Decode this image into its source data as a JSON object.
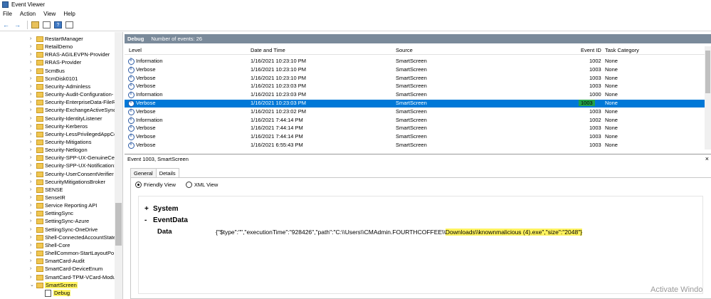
{
  "window": {
    "title": "Event Viewer"
  },
  "menu": [
    "File",
    "Action",
    "View",
    "Help"
  ],
  "toolbar": {
    "back_icon": "arrow-left-icon",
    "forward_icon": "arrow-right-icon",
    "folder_icon": "folder-up-icon",
    "properties_icon": "properties-icon",
    "help_icon": "help-icon",
    "panel_icon": "show-hide-pane-icon",
    "help_label": "?"
  },
  "tree": {
    "items": [
      "RestartManager",
      "RetailDemo",
      "RRAS-AGILEVPN-Provider",
      "RRAS-Provider",
      "ScmBus",
      "ScmDisk0101",
      "Security-Adminless",
      "Security-Audit-Configuration-",
      "Security-EnterpriseData-FileRe",
      "Security-ExchangeActiveSync",
      "Security-IdentityListener",
      "Security-Kerberos",
      "Security-LessPrivilegedAppCo",
      "Security-Mitigations",
      "Security-Netlogon",
      "Security-SPP-UX-GenuineCen",
      "Security-SPP-UX-Notification:",
      "Security-UserConsentVerifier",
      "SecurityMitigationsBroker",
      "SENSE",
      "SenseIR",
      "Service Reporting API",
      "SettingSync",
      "SettingSync-Azure",
      "SettingSync-OneDrive",
      "Shell-ConnectedAccountState",
      "Shell-Core",
      "ShellCommon-StartLayoutPo",
      "SmartCard-Audit",
      "SmartCard-DeviceEnum",
      "SmartCard-TPM-VCard-Modu"
    ],
    "selected": "SmartScreen",
    "child": "Debug"
  },
  "log": {
    "name": "Debug",
    "count_label": "Number of events: 26"
  },
  "grid": {
    "columns": [
      "Level",
      "Date and Time",
      "Source",
      "Event ID",
      "Task Category"
    ],
    "rows": [
      [
        "Information",
        "1/16/2021 10:23:10 PM",
        "SmartScreen",
        "1002",
        "None"
      ],
      [
        "Verbose",
        "1/16/2021 10:23:10 PM",
        "SmartScreen",
        "1003",
        "None"
      ],
      [
        "Verbose",
        "1/16/2021 10:23:10 PM",
        "SmartScreen",
        "1003",
        "None"
      ],
      [
        "Verbose",
        "1/16/2021 10:23:03 PM",
        "SmartScreen",
        "1003",
        "None"
      ],
      [
        "Information",
        "1/16/2021 10:23:03 PM",
        "SmartScreen",
        "1000",
        "None"
      ],
      [
        "Verbose",
        "1/16/2021 10:23:03 PM",
        "SmartScreen",
        "1003",
        "None"
      ],
      [
        "Verbose",
        "1/16/2021 10:23:02 PM",
        "SmartScreen",
        "1003",
        "None"
      ],
      [
        "Information",
        "1/16/2021 7:44:14 PM",
        "SmartScreen",
        "1002",
        "None"
      ],
      [
        "Verbose",
        "1/16/2021 7:44:14 PM",
        "SmartScreen",
        "1003",
        "None"
      ],
      [
        "Verbose",
        "1/16/2021 7:44:14 PM",
        "SmartScreen",
        "1003",
        "None"
      ],
      [
        "Verbose",
        "1/16/2021 6:55:43 PM",
        "SmartScreen",
        "1003",
        "None"
      ]
    ],
    "selected_index": 5
  },
  "detail": {
    "title": "Event 1003, SmartScreen",
    "close": "×",
    "tabs": [
      "General",
      "Details"
    ],
    "active_tab": "Details",
    "views": [
      "Friendly View",
      "XML View"
    ],
    "selected_view": "Friendly View",
    "system_node": "System",
    "system_sign": "+",
    "eventdata_node": "EventData",
    "eventdata_sign": "-",
    "data_label": "Data",
    "data_prefix": "{\"$type\":\"\",\"executionTime\":\"928426\",\"path\":\"C:\\\\Users\\\\CMAdmin.FOURTHCOFFEE\\\\",
    "data_highlight": "Downloads\\\\knownmalicious (4).exe\",\"size\":\"2048\"}"
  },
  "watermark": "Activate Windo",
  "colors": {
    "selection": "#0078d7",
    "highlight": "#fff35e",
    "event_id_highlight": "#21a24a",
    "pane_header": "#7a8a9a"
  }
}
